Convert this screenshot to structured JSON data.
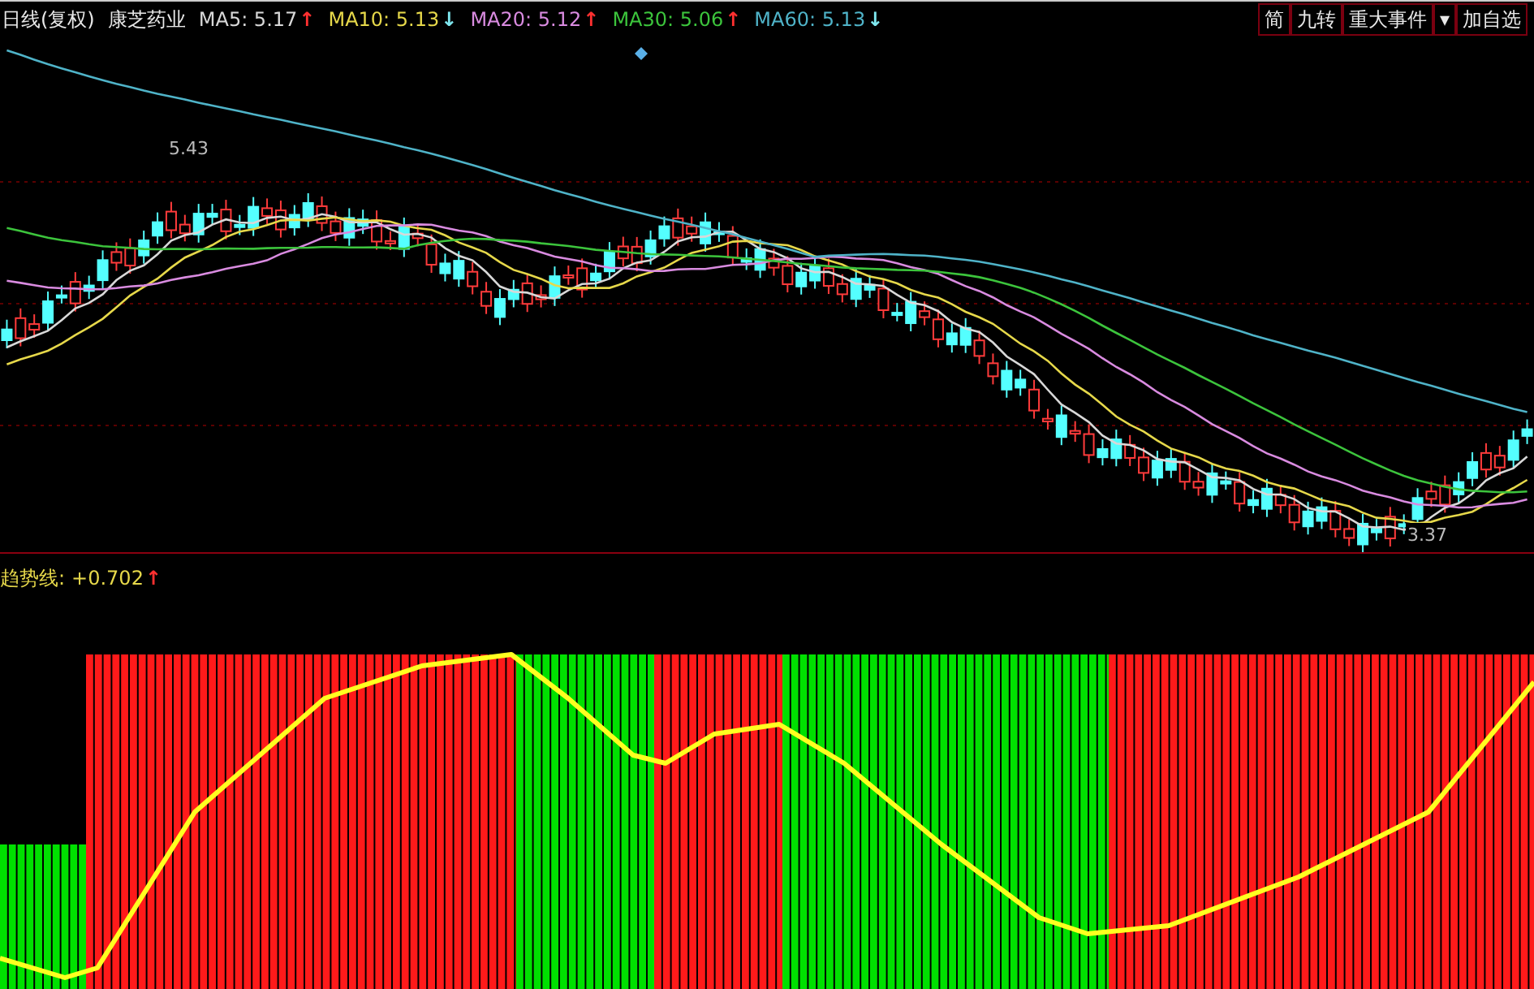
{
  "header": {
    "period": "日线(复权)",
    "stock": "康芝药业",
    "averages": [
      {
        "label": "MA5: 5.17",
        "color": "#d8d8d8",
        "arrow": "↑",
        "rising": true
      },
      {
        "label": "MA10: 5.13",
        "color": "#e6d84a",
        "arrow": "↓",
        "rising": false
      },
      {
        "label": "MA20: 5.12",
        "color": "#d98be0",
        "arrow": "↑",
        "rising": true
      },
      {
        "label": "MA30: 5.06",
        "color": "#3cc43c",
        "arrow": "↑",
        "rising": true
      },
      {
        "label": "MA60: 5.13",
        "color": "#4fb3c8",
        "arrow": "↓",
        "rising": false
      }
    ],
    "buttons": [
      "简",
      "九转",
      "重大事件",
      "▾",
      "加自选"
    ]
  },
  "price_chart": {
    "high_label": "5.43",
    "low_label": "3.37"
  },
  "indicator": {
    "label": "趋势线:",
    "reading": "+0.702",
    "arrow": "↑",
    "rising": true
  }
}
